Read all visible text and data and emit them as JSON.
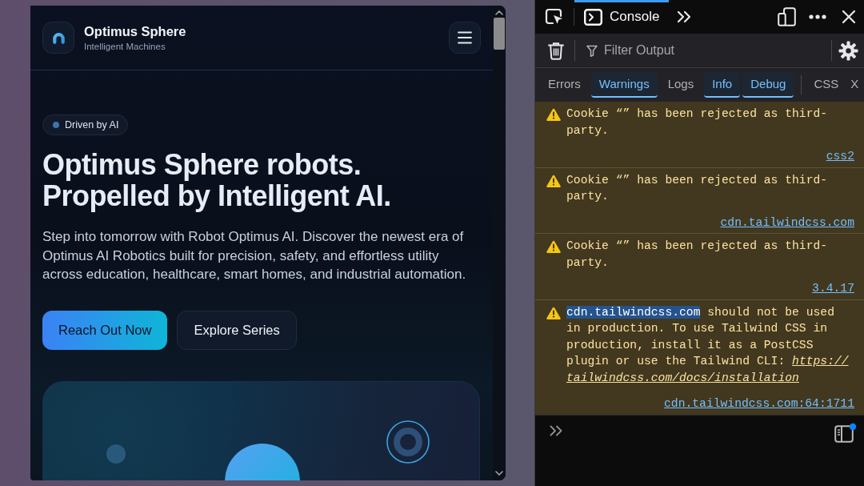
{
  "browser": {
    "brand": {
      "title": "Optimus Sphere",
      "subtitle": "Intelligent Machines"
    },
    "badge": {
      "label": "Driven by AI"
    },
    "headline": "Optimus Sphere robots. Propelled by Intelligent AI.",
    "description": "Step into tomorrow with Robot Optimus AI. Discover the newest era of Optimus AI Robotics built for precision, safety, and effortless utility across education, healthcare, smart homes, and industrial automation.",
    "buttons": [
      {
        "label": "Reach Out Now",
        "kind": "primary"
      },
      {
        "label": "Explore Series",
        "kind": "secondary"
      }
    ]
  },
  "devtools": {
    "tabs": [
      {
        "label": "Console",
        "selected": true
      }
    ],
    "filter": {
      "placeholder": "Filter Output"
    },
    "categories": {
      "levels": [
        {
          "label": "Errors",
          "selected": false
        },
        {
          "label": "Warnings",
          "selected": true
        },
        {
          "label": "Logs",
          "selected": false
        },
        {
          "label": "Info",
          "selected": true
        },
        {
          "label": "Debug",
          "selected": true
        }
      ],
      "types": [
        {
          "label": "CSS",
          "selected": false
        },
        {
          "label": "X",
          "selected": false
        }
      ]
    },
    "messages": [
      {
        "kind": "warning",
        "segments": [
          {
            "kind": "text",
            "text": "Cookie “” has been rejected as third-party.",
            "selected": false
          }
        ],
        "source": "css2"
      },
      {
        "kind": "warning",
        "segments": [
          {
            "kind": "text",
            "text": "Cookie “” has been rejected as third-party.",
            "selected": false
          }
        ],
        "source": "cdn.tailwindcss.com"
      },
      {
        "kind": "warning",
        "segments": [
          {
            "kind": "text",
            "text": "Cookie “” has been rejected as third-party.",
            "selected": false
          }
        ],
        "source": "3.4.17"
      },
      {
        "kind": "warning",
        "segments": [
          {
            "kind": "text",
            "text": "cdn.tailwindcss.com",
            "selected": true
          },
          {
            "kind": "text",
            "text": "should not be used in production. To use Tailwind CSS in production, install it as a PostCSS plugin or use the Tailwind CLI:",
            "selected": false
          },
          {
            "kind": "link",
            "text": "https://",
            "selected": false
          },
          {
            "kind": "link",
            "text": "tailwindcss.com/docs/installation",
            "selected": false
          }
        ],
        "source": "cdn.tailwindcss.com:64:1711"
      }
    ]
  }
}
